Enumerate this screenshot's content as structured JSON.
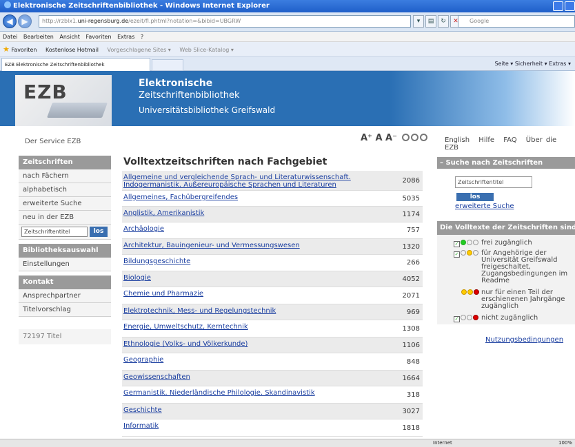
{
  "window": {
    "title": "Elektronische Zeitschriftenbibliothek - Windows Internet Explorer"
  },
  "browser": {
    "address_gray": "http://rzblx1.",
    "address_bold": "uni-regensburg.de",
    "address_rest": "/ezeit/fl.phtml?notation=&bibid=UBGRW",
    "search_placeholder": "Google",
    "menu": [
      "Datei",
      "Bearbeiten",
      "Ansicht",
      "Favoriten",
      "Extras",
      "?"
    ],
    "favorites_label": "Favoriten",
    "favs": [
      "Kostenlose Hotmail",
      "Vorgeschlagene Sites ▾",
      "Web Slice-Katalog ▾"
    ],
    "tab_label": "EZB Elektronische Zeitschriftenbibliothek",
    "commands": "Seite ▾   Sicherheit ▾   Extras ▾",
    "status_zone": "Internet",
    "status_zoom": "100%"
  },
  "header": {
    "logo_text": "EZB",
    "logo_sub": "Elektronische Zeitschriftenbibliothek",
    "line1": "Elektronische",
    "line2": "Zeitschriftenbibliothek",
    "line3": "Universitätsbibliothek Greifswald"
  },
  "service": "Der Service EZB",
  "fontctl": "A⁺ A A⁻",
  "toplinks": [
    "English",
    "Hilfe",
    "FAQ",
    "Über die EZB"
  ],
  "sidebar": {
    "sec1_head": "Zeitschriften",
    "sec1_items": [
      "nach Fächern",
      "alphabetisch",
      "erweiterte Suche",
      "neu in der EZB"
    ],
    "search_placeholder": "Zeitschriftentitel",
    "search_btn": "los",
    "sec2_head": "Bibliotheksauswahl",
    "sec2_items": [
      "Einstellungen"
    ],
    "sec3_head": "Kontakt",
    "sec3_items": [
      "Ansprechpartner",
      "Titelvorschlag"
    ],
    "count": "72197 Titel"
  },
  "main": {
    "title": "Volltextzeitschriften nach Fachgebiet",
    "rows": [
      {
        "label": "Allgemeine und vergleichende Sprach- und Literaturwissenschaft. Indogermanistik. Außereuropäische Sprachen und Literaturen",
        "count": "2086"
      },
      {
        "label": "Allgemeines, Fachübergreifendes",
        "count": "5035"
      },
      {
        "label": "Anglistik, Amerikanistik",
        "count": "1174"
      },
      {
        "label": "Archäologie",
        "count": "757"
      },
      {
        "label": "Architektur, Bauingenieur- und Vermessungswesen",
        "count": "1320"
      },
      {
        "label": "Bildungsgeschichte",
        "count": "266"
      },
      {
        "label": "Biologie",
        "count": "4052"
      },
      {
        "label": "Chemie und Pharmazie",
        "count": "2071"
      },
      {
        "label": "Elektrotechnik, Mess- und Regelungstechnik",
        "count": "969"
      },
      {
        "label": "Energie, Umweltschutz, Kerntechnik",
        "count": "1308"
      },
      {
        "label": "Ethnologie (Volks- und Völkerkunde)",
        "count": "1106"
      },
      {
        "label": "Geographie",
        "count": "848"
      },
      {
        "label": "Geowissenschaften",
        "count": "1664"
      },
      {
        "label": "Germanistik. Niederländische Philologie. Skandinavistik",
        "count": "318"
      },
      {
        "label": "Geschichte",
        "count": "3027"
      },
      {
        "label": "Informatik",
        "count": "1818"
      }
    ]
  },
  "right": {
    "search_head": "– Suche nach Zeitschriften",
    "search_placeholder": "Zeitschriftentitel",
    "search_btn": "los",
    "adv_link": "erweiterte Suche",
    "legend_head": "Die Volltexte der Zeitschriften sind",
    "legend": [
      "frei zugänglich",
      "für Angehörige der Universität Greifswald freigeschaltet, Zugangsbedingungen im Readme",
      "nur für einen Teil der erschienenen Jahrgänge zugänglich",
      "nicht zugänglich"
    ],
    "terms_link": "Nutzungsbedingungen"
  }
}
